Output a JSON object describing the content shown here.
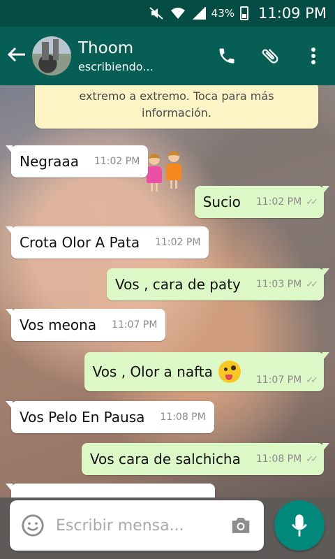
{
  "status_bar": {
    "battery": "43%",
    "time": "11:09 PM"
  },
  "header": {
    "contact_name": "Thoom",
    "contact_status": "escribiendo..."
  },
  "notice": {
    "line1": "extremo a extremo. Toca para más",
    "line2": "información."
  },
  "messages": [
    {
      "direction": "in",
      "text": "Negraaa",
      "time": "11:02 PM"
    },
    {
      "direction": "out",
      "text": "Sucio",
      "time": "11:02 PM"
    },
    {
      "direction": "in",
      "text": "Crota Olor A Pata",
      "time": "11:02 PM"
    },
    {
      "direction": "out",
      "text": "Vos , cara de paty",
      "time": "11:03 PM"
    },
    {
      "direction": "in",
      "text": "Vos meona",
      "time": "11:07 PM"
    },
    {
      "direction": "out",
      "text": "Vos , Olor a nafta",
      "time": "11:07 PM",
      "emoji": "winking-tongue-emoji"
    },
    {
      "direction": "in",
      "text": "Vos Pelo En Pausa",
      "time": "11:08 PM"
    },
    {
      "direction": "out",
      "text": "Vos cara de salchicha",
      "time": "11:08 PM"
    }
  ],
  "input": {
    "placeholder": "Escribir mensa..."
  },
  "colors": {
    "header": "#075e54",
    "status_bar": "#054d44",
    "outgoing": "#dcf8c6",
    "incoming": "#ffffff",
    "fab": "#00897b"
  },
  "icons": [
    "back-arrow-icon",
    "phone-icon",
    "attach-icon",
    "more-vert-icon",
    "emoji-icon",
    "camera-icon",
    "mic-icon",
    "double-check-icon"
  ]
}
